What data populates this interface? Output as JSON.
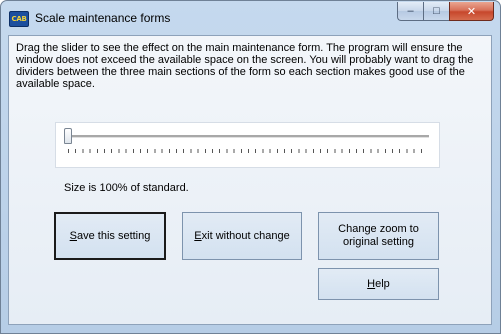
{
  "window": {
    "title": "Scale maintenance forms",
    "app_icon_text": "CAB",
    "controls": {
      "minimize": "–",
      "maximize": "□",
      "close": "✕"
    }
  },
  "description": "Drag the slider to see the effect on the main maintenance form.  The program will ensure the window does not exceed the available space on the screen.  You will probably want to drag the dividers between the three main sections of the form so each section makes good use of the available space.",
  "slider": {
    "value_percent": 100,
    "position_fraction": 0.0
  },
  "size_label": "Size is 100% of standard.",
  "buttons": {
    "save": {
      "mnemonic": "S",
      "rest": "ave this setting"
    },
    "exit": {
      "mnemonic": "E",
      "rest": "xit without change"
    },
    "reset": {
      "label": "Change zoom to original setting"
    },
    "help": {
      "mnemonic": "H",
      "rest": "elp"
    }
  }
}
